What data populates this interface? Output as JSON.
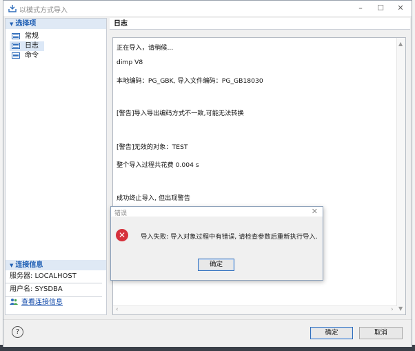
{
  "window": {
    "title": "以模式方式导入",
    "minimize": "–",
    "maximize": "☐",
    "close": "✕"
  },
  "left_panel": {
    "section_title": "选择项",
    "tree": [
      {
        "label": "常规"
      },
      {
        "label": "日志"
      },
      {
        "label": "命令"
      }
    ],
    "connection": {
      "section_title": "连接信息",
      "server": "服务器: LOCALHOST",
      "user": "用户名: SYSDBA",
      "view_link": "查看连接信息"
    }
  },
  "right_panel": {
    "header": "日志",
    "log_lines": [
      "正在导入，请稍候...",
      "dimp V8",
      "本地编码：PG_GBK, 导入文件编码：PG_GB18030",
      "[警告]导入导出编码方式不一致,可能无法转换",
      "[警告]无效的对象：TEST",
      "整个导入过程共花费    0.004 s",
      "成功终止导入, 但出现警告"
    ]
  },
  "error_dialog": {
    "title": "错误",
    "message": "导入失败: 导入对象过程中有错误, 请检查参数后重新执行导入.",
    "ok": "确定"
  },
  "footer": {
    "help": "?",
    "ok": "确定",
    "cancel": "取消"
  },
  "colors": {
    "accent": "#1f5fb4",
    "error": "#d6313c"
  }
}
